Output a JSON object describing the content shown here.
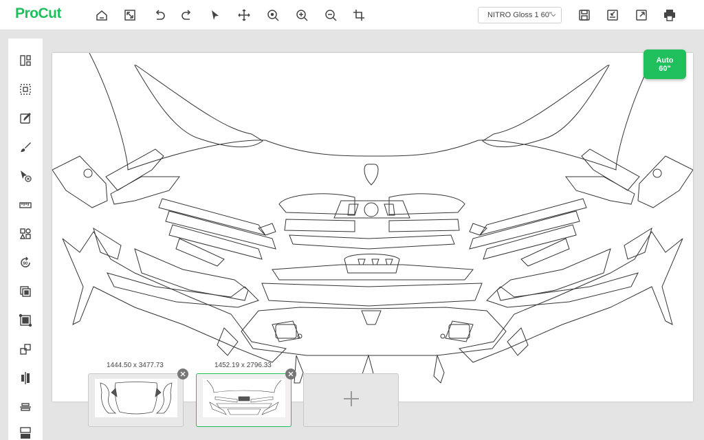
{
  "app": {
    "logo": "ProCut"
  },
  "toolbar": {
    "icons": [
      "home-icon",
      "fit-screen-icon",
      "undo-icon",
      "redo-icon",
      "select-arrow-icon",
      "move-icon",
      "zoom-area-icon",
      "zoom-in-icon",
      "zoom-out-icon",
      "crop-icon"
    ],
    "material": "NITRO Gloss 1 60\"",
    "right_icons": [
      "save-icon",
      "import-icon",
      "export-icon",
      "print-icon"
    ]
  },
  "sidebar": {
    "tools": [
      "layout-icon",
      "group-select-icon",
      "edit-icon",
      "brush-icon",
      "cursor-delete-icon",
      "ruler-icon",
      "shapes-icon",
      "rotate-90-icon",
      "layers-icon",
      "weed-box-icon",
      "arrange-icon",
      "align-center-icon",
      "distribute-icon",
      "align-bottom-icon"
    ]
  },
  "canvas": {
    "auto_button": {
      "line1": "Auto",
      "line2": "60\""
    }
  },
  "sheets": [
    {
      "label": "1444.50 x 3477.73",
      "active": false
    },
    {
      "label": "1452.19 x 2796.33",
      "active": true
    }
  ],
  "colors": {
    "brand": "#1fbf5c",
    "outline": "#333333"
  }
}
